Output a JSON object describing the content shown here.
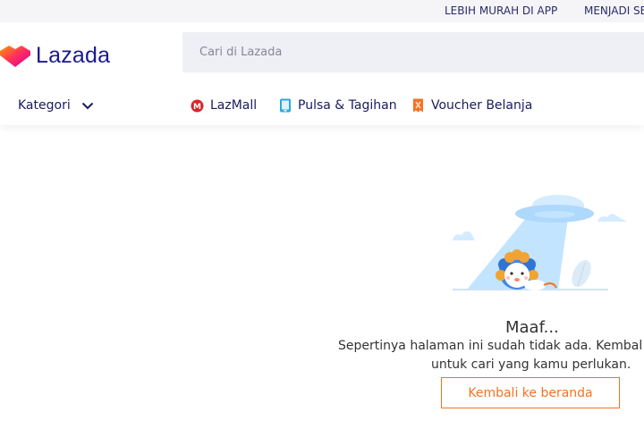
{
  "topbar": {
    "app_link": "LEBIH MURAH DI APP",
    "seller_link": "MENJADI SE"
  },
  "header": {
    "logo_text": "Lazada",
    "search_placeholder": "Cari di Lazada",
    "kategori_label": "Kategori",
    "nav": [
      {
        "label": "LazMall",
        "icon": "lazmall-icon"
      },
      {
        "label": "Pulsa & Tagihan",
        "icon": "phone-icon"
      },
      {
        "label": "Voucher Belanja",
        "icon": "voucher-icon"
      }
    ]
  },
  "error": {
    "title": "Maaf...",
    "message_line1": "Sepertinya halaman ini sudah tidak ada. Kembal",
    "message_line2": "untuk cari yang kamu perlukan.",
    "button_label": "Kembali ke beranda"
  },
  "colors": {
    "brand_navy": "#1a1a8f",
    "accent_orange": "#f57224",
    "search_bg": "#eff0f5"
  }
}
